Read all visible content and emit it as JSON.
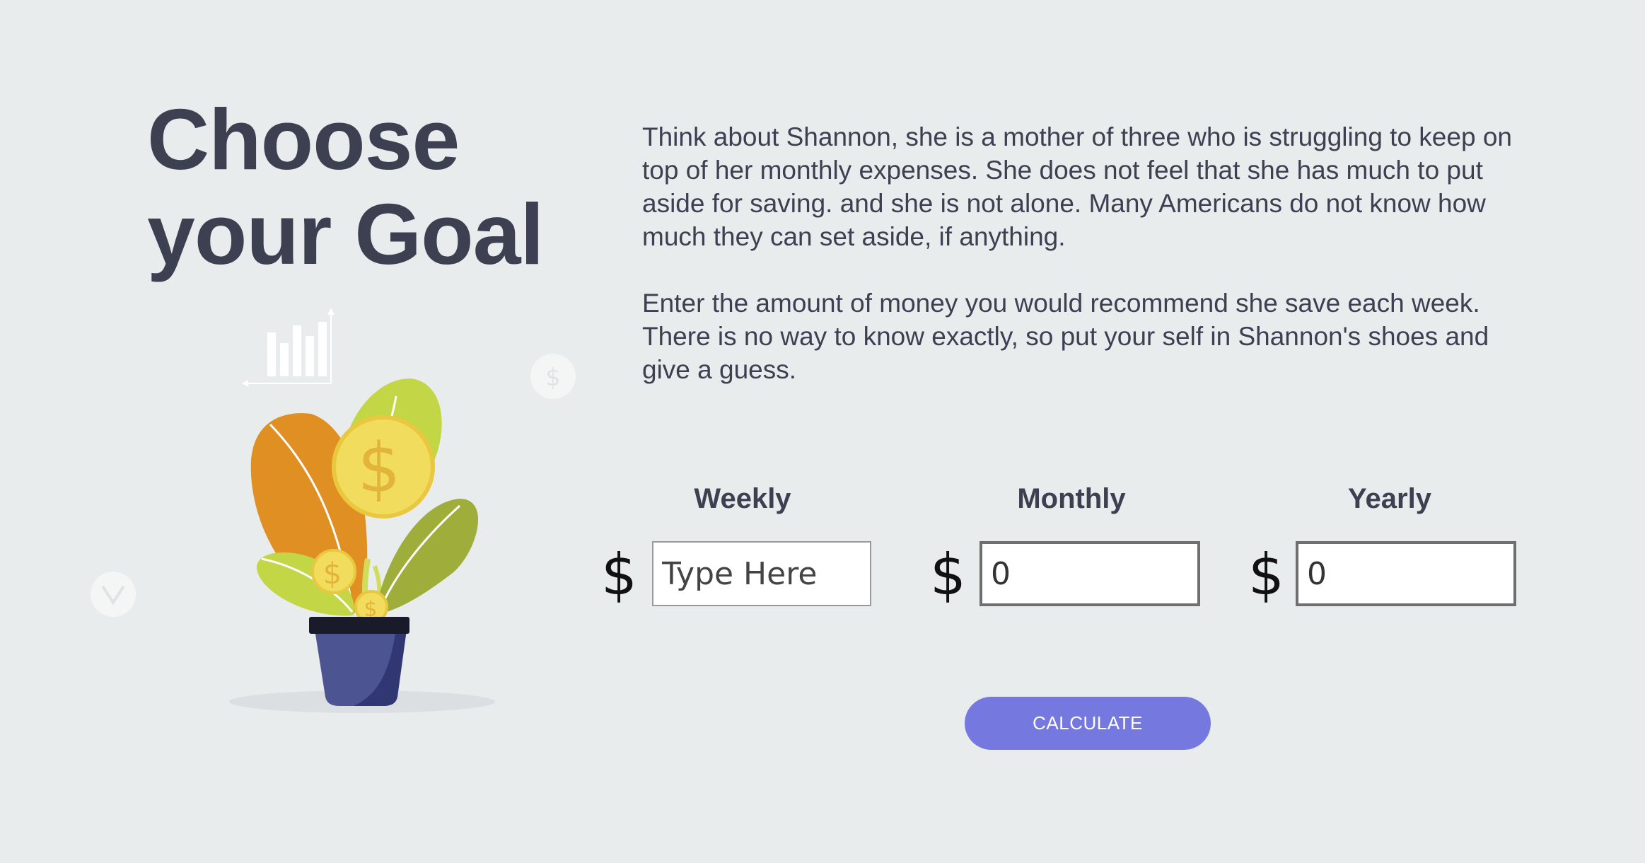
{
  "heading": {
    "line1": "Choose",
    "line2": "your Goal"
  },
  "intro": {
    "paragraph1": "Think about Shannon, she is a mother of three who is struggling to keep on top of her monthly expenses. She does not feel that she has much to put aside for saving. and she is not alone. Many Americans do not know how much they can set aside, if anything.",
    "paragraph2": "Enter the amount of money you would recommend she save each week. There is no way to know exactly, so put your self in Shannon's shoes and give a guess."
  },
  "inputs": {
    "weekly": {
      "label": "Weekly",
      "currency": "$",
      "placeholder": "Type Here",
      "value": ""
    },
    "monthly": {
      "label": "Monthly",
      "currency": "$",
      "value": "0"
    },
    "yearly": {
      "label": "Yearly",
      "currency": "$",
      "value": "0"
    }
  },
  "calculate_button": {
    "label": "CALCULATE",
    "color": "#7579df"
  },
  "illustration": {
    "icons": [
      "bar-chart-icon",
      "dollar-coin-icon",
      "plant-pot-icon",
      "chevron-down-icon"
    ],
    "coin_symbol": "$"
  },
  "colors": {
    "background": "#e9eced",
    "text": "#3d4050",
    "accent": "#7579df",
    "leaf_orange": "#e09022",
    "leaf_green": "#c2d646",
    "leaf_dark_green": "#9fae3b",
    "coin": "#f2dc5d",
    "pot": "#4c5592"
  }
}
